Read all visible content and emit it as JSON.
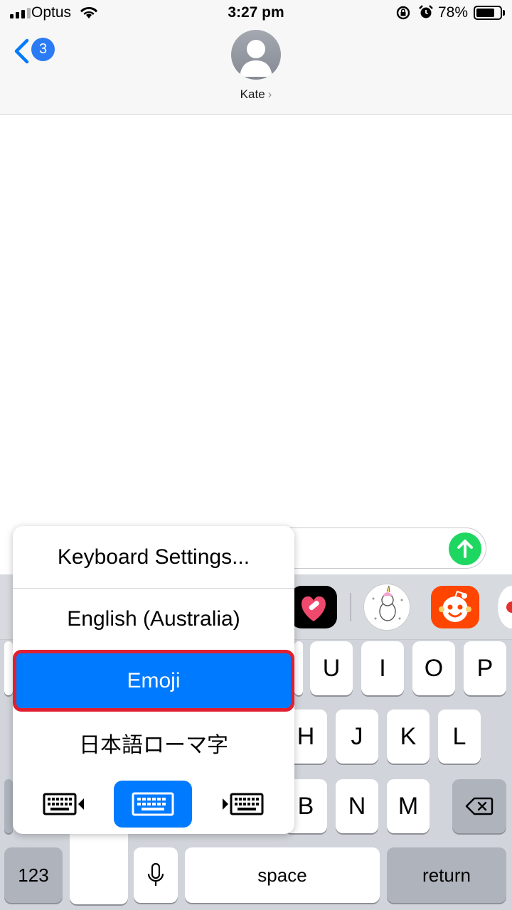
{
  "status_bar": {
    "carrier": "Optus",
    "time": "3:27 pm",
    "battery_percent": "78%",
    "battery_level": 0.78,
    "icons": [
      "signal-icon",
      "wifi-icon",
      "rotation-lock-icon",
      "alarm-icon",
      "battery-icon"
    ]
  },
  "header": {
    "unread_count": "3",
    "contact_name": "Kate",
    "chevron": "›"
  },
  "input": {
    "placeholder_tail": "e"
  },
  "app_strip": {
    "icons": [
      "heart-sticker-app-icon",
      "unicorn-sticker-app-icon",
      "reddit-app-icon"
    ],
    "colors": {
      "reddit": "#ff4500",
      "send": "#1ed760",
      "accent": "#007aff"
    }
  },
  "keyboard": {
    "row1": [
      "U",
      "I",
      "O",
      "P"
    ],
    "row2": [
      "H",
      "J",
      "K",
      "L"
    ],
    "row3": [
      "B",
      "N",
      "M"
    ],
    "numbers_label": "123",
    "space_label": "space",
    "return_label": "return"
  },
  "language_menu": {
    "items": [
      "Keyboard Settings...",
      "English (Australia)",
      "Emoji",
      "日本語ローマ字"
    ],
    "selected": "Emoji",
    "highlight_color": "#e02030",
    "modes": [
      "keyboard-left-icon",
      "keyboard-full-icon",
      "keyboard-right-icon"
    ]
  }
}
